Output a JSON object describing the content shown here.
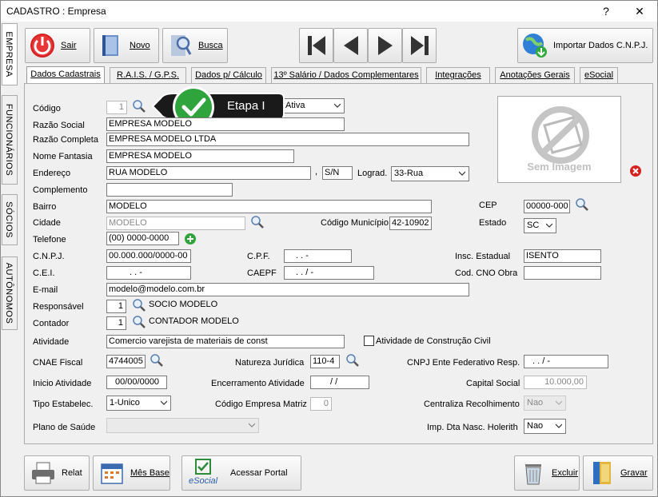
{
  "window": {
    "title": "CADASTRO : Empresa",
    "help": "?",
    "close": "✕"
  },
  "side_tabs": [
    "EMPRESA",
    "FUNCIONÁRIOS",
    "SÓCIOS",
    "AUTÔNOMOS"
  ],
  "toolbar": {
    "sair": "Sair",
    "novo": "Novo",
    "busca": "Busca",
    "importar": "Importar Dados C.N.P.J."
  },
  "tabs": [
    "Dados Cadastrais",
    "R.A.I.S. / G.P.S.",
    "Dados p/ Cálculo",
    "13º Salário / Dados Complementares",
    "Integrações",
    "Anotações Gerais",
    "eSocial"
  ],
  "callout": {
    "text": "Etapa I"
  },
  "photo": {
    "text": "Sem Imagem"
  },
  "form": {
    "codigo": {
      "label": "Código",
      "value": "1",
      "status": "Ativa"
    },
    "razao_social": {
      "label": "Razão Social",
      "value": "EMPRESA MODELO"
    },
    "razao_completa": {
      "label": "Razão Completa",
      "value": "EMPRESA MODELO LTDA"
    },
    "nome_fantasia": {
      "label": "Nome Fantasia",
      "value": "EMPRESA MODELO"
    },
    "endereco": {
      "label": "Endereço",
      "value": "RUA MODELO",
      "sep": ",",
      "numero": "S/N",
      "lograd_label": "Lograd.",
      "lograd": "33-Rua"
    },
    "complemento": {
      "label": "Complemento",
      "value": ""
    },
    "bairro": {
      "label": "Bairro",
      "value": "MODELO",
      "cep_label": "CEP",
      "cep": "00000-000"
    },
    "cidade": {
      "label": "Cidade",
      "value": "MODELO",
      "codmun_label": "Código Município",
      "codmun": "42-10902",
      "estado_label": "Estado",
      "estado": "SC"
    },
    "telefone": {
      "label": "Telefone",
      "value": "(00) 0000-0000"
    },
    "cnpj": {
      "label": "C.N.P.J.",
      "value": "00.000.000/0000-00",
      "cpf_label": "C.P.F.",
      "cpf": ".   .   -",
      "insc_label": "Insc. Estadual",
      "insc": "ISENTO"
    },
    "cei": {
      "label": "C.E.I.",
      "value": ".   .   -",
      "caepf_label": "CAEPF",
      "caepf": ".   .   /   -",
      "cno_label": "Cod. CNO Obra",
      "cno": ""
    },
    "email": {
      "label": "E-mail",
      "value": "modelo@modelo.com.br"
    },
    "responsavel": {
      "label": "Responsável",
      "value": "1",
      "name": "SOCIO MODELO"
    },
    "contador": {
      "label": "Contador",
      "value": "1",
      "name": "CONTADOR MODELO"
    },
    "atividade": {
      "label": "Atividade",
      "value": "Comercio varejista de materiais de const",
      "construcao_label": "Atividade de Construção Civil"
    },
    "cnae": {
      "label": "CNAE Fiscal",
      "value": "4744005",
      "natureza_label": "Natureza Jurídica",
      "natureza": "110-4",
      "ente_label": "CNPJ Ente Federativo Resp.",
      "ente": ".   .   /   -"
    },
    "inicio": {
      "label": "Inicio Atividade",
      "value": "00/00/0000",
      "encerramento_label": "Encerramento Atividade",
      "encerramento": "/ /",
      "capital_label": "Capital Social",
      "capital": "10.000,00"
    },
    "tipo": {
      "label": "Tipo Estabelec.",
      "value": "1-Unico",
      "matriz_label": "Código Empresa Matriz",
      "matriz": "0",
      "centraliza_label": "Centraliza Recolhimento",
      "centraliza": "Nao"
    },
    "plano": {
      "label": "Plano de Saúde",
      "value": "",
      "imp_label": "Imp. Dta Nasc. Holerith",
      "imp": "Nao"
    }
  },
  "bottom": {
    "relat": "Relat",
    "mesbase": "Mês Base",
    "portal": "Acessar Portal",
    "excluir": "Excluir",
    "gravar": "Gravar",
    "esocial_logo": "eSocial"
  }
}
